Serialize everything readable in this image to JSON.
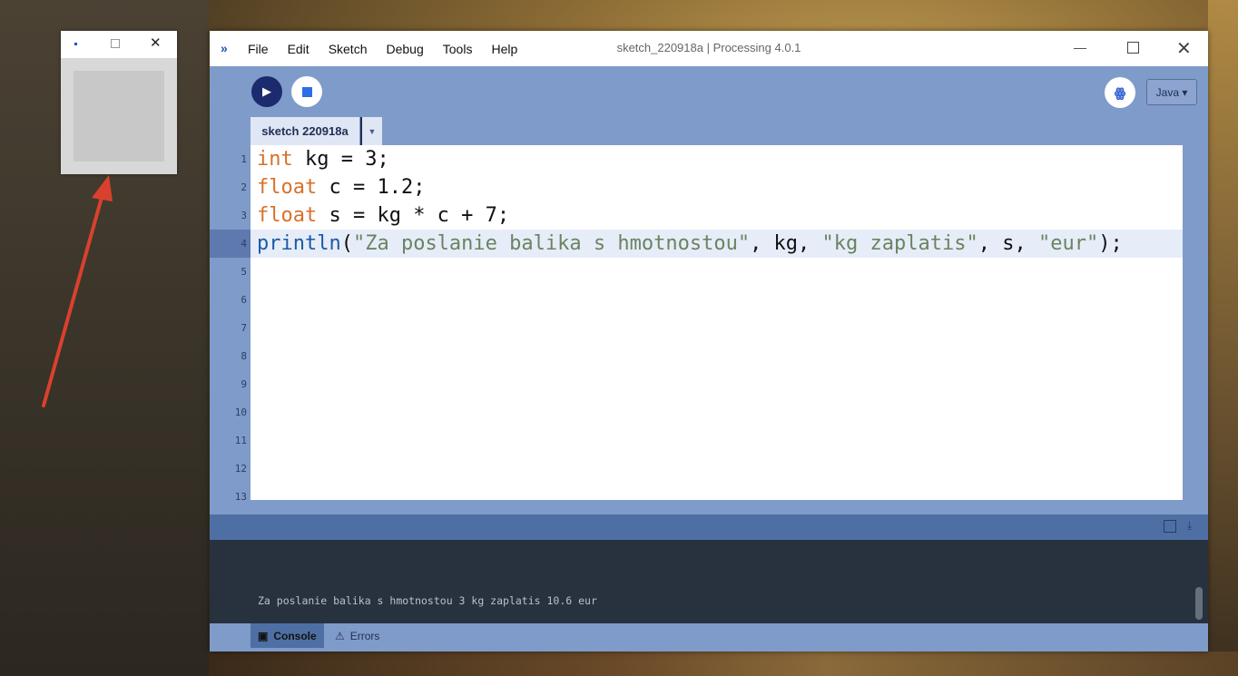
{
  "mini_window": {
    "close_symbol": "✕"
  },
  "main_window": {
    "title": "sketch_220918a | Processing 4.0.1",
    "menu": [
      "File",
      "Edit",
      "Sketch",
      "Debug",
      "Tools",
      "Help"
    ],
    "close_symbol": "✕"
  },
  "toolbar": {
    "run_symbol": "▶",
    "debug_symbol": "ꙮ",
    "mode_label": "Java ▾"
  },
  "tabs": {
    "active": "sketch 220918a",
    "menu_symbol": "▼"
  },
  "editor": {
    "line_numbers": [
      "1",
      "2",
      "3",
      "4",
      "5",
      "6",
      "7",
      "8",
      "9",
      "10",
      "11",
      "12",
      "13"
    ],
    "lines": [
      [
        {
          "t": "int",
          "c": "kw"
        },
        {
          "t": " kg = 3;",
          "c": ""
        }
      ],
      [
        {
          "t": "float",
          "c": "kw"
        },
        {
          "t": " c = 1.2;",
          "c": ""
        }
      ],
      [
        {
          "t": "float",
          "c": "kw"
        },
        {
          "t": " s = kg * c + 7;",
          "c": ""
        }
      ],
      [
        {
          "t": "println",
          "c": "fn"
        },
        {
          "t": "(",
          "c": ""
        },
        {
          "t": "\"Za poslanie balika s hmotnostou\"",
          "c": "str"
        },
        {
          "t": ", kg, ",
          "c": ""
        },
        {
          "t": "\"kg zaplatis\"",
          "c": "str"
        },
        {
          "t": ", s, ",
          "c": ""
        },
        {
          "t": "\"eur\"",
          "c": "str"
        },
        {
          "t": ");",
          "c": ""
        }
      ]
    ],
    "highlighted_line": 4
  },
  "console": {
    "output": "Za poslanie balika s hmotnostou 3 kg zaplatis 10.6 eur"
  },
  "footer": {
    "console_label": "Console",
    "errors_label": "Errors",
    "console_icon": "▣",
    "errors_icon": "⚠"
  },
  "colors": {
    "accent": "#7f9bc9",
    "keyword": "#d8712a",
    "function": "#1c5aa6",
    "string": "#6b8360",
    "arrow": "#d9412e"
  }
}
